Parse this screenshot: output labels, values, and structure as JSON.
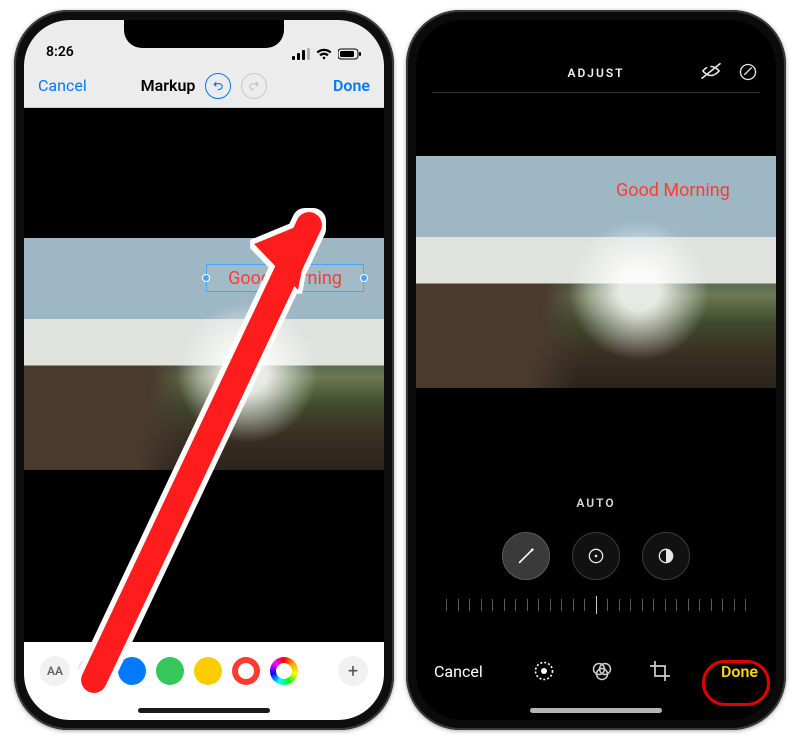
{
  "left": {
    "statusbar": {
      "time": "8:26"
    },
    "nav": {
      "cancel": "Cancel",
      "title": "Markup",
      "done": "Done"
    },
    "textbox_value": "Good Morning",
    "toolbar": {
      "text_style_label": "AA",
      "colors": [
        "#000000",
        "#007aff",
        "#34c759",
        "#ffcc00",
        "#ff3b30",
        "rainbow"
      ],
      "selected_color_index": 4
    }
  },
  "right": {
    "top": {
      "title": "ADJUST"
    },
    "text_label": "Good Morning",
    "auto_label": "AUTO",
    "tabbar": {
      "cancel": "Cancel",
      "done": "Done"
    }
  }
}
